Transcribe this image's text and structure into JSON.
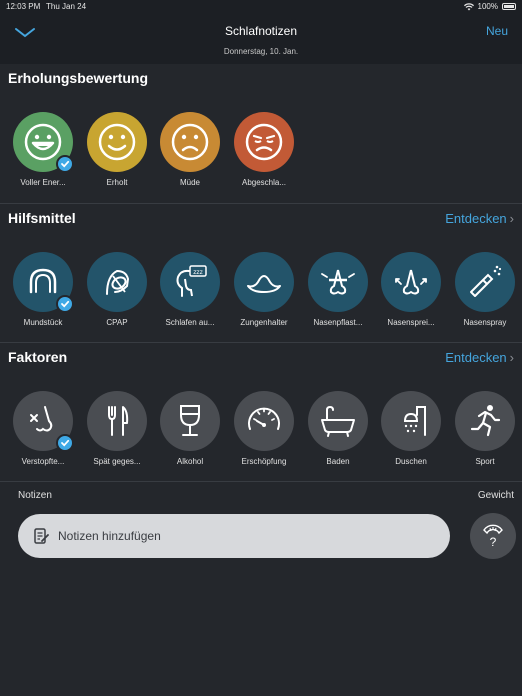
{
  "status_bar": {
    "time": "12:03 PM",
    "date": "Thu Jan 24",
    "battery": "100%"
  },
  "nav": {
    "title": "Schlafnotizen",
    "subtitle": "Donnerstag, 10. Jan.",
    "new_label": "Neu"
  },
  "recovery": {
    "title": "Erholungsbewertung",
    "items": [
      {
        "label": "Voller Ener...",
        "icon": "grinning-face-icon",
        "color": "#5aa063",
        "checked": true
      },
      {
        "label": "Erholt",
        "icon": "smiling-face-icon",
        "color": "#c8a531",
        "checked": false
      },
      {
        "label": "Müde",
        "icon": "sad-face-icon",
        "color": "#c88a34",
        "checked": false
      },
      {
        "label": "Abgeschla...",
        "icon": "exhausted-face-icon",
        "color": "#c25a36",
        "checked": false
      }
    ]
  },
  "aids": {
    "title": "Hilfsmittel",
    "link": "Entdecken",
    "items": [
      {
        "label": "Mundstück",
        "icon": "mouthguard-icon",
        "checked": true
      },
      {
        "label": "CPAP",
        "icon": "cpap-icon",
        "checked": false
      },
      {
        "label": "Schlafen au...",
        "icon": "sleep-head-icon",
        "checked": false
      },
      {
        "label": "Zungenhalter",
        "icon": "tongue-holder-icon",
        "checked": false
      },
      {
        "label": "Nasenpflast...",
        "icon": "nasal-strip-icon",
        "checked": false
      },
      {
        "label": "Nasensprei...",
        "icon": "nasal-dilator-icon",
        "checked": false
      },
      {
        "label": "Nasenspray",
        "icon": "nasal-spray-icon",
        "checked": false
      }
    ]
  },
  "factors": {
    "title": "Faktoren",
    "link": "Entdecken",
    "items": [
      {
        "label": "Verstopfte...",
        "icon": "congested-nose-icon",
        "checked": true
      },
      {
        "label": "Spät geges...",
        "icon": "fork-knife-icon",
        "checked": false
      },
      {
        "label": "Alkohol",
        "icon": "wine-glass-icon",
        "checked": false
      },
      {
        "label": "Erschöpfung",
        "icon": "gauge-icon",
        "checked": false
      },
      {
        "label": "Baden",
        "icon": "bathtub-icon",
        "checked": false
      },
      {
        "label": "Duschen",
        "icon": "shower-icon",
        "checked": false
      },
      {
        "label": "Sport",
        "icon": "running-icon",
        "checked": false
      }
    ]
  },
  "notes": {
    "label": "Notizen",
    "placeholder": "Notizen hinzufügen"
  },
  "weight": {
    "label": "Gewicht",
    "value": "?"
  },
  "colors": {
    "accent": "#45a5dd",
    "background": "#24272c",
    "aid_circle": "#23546a",
    "factor_circle": "#4a4d52"
  }
}
